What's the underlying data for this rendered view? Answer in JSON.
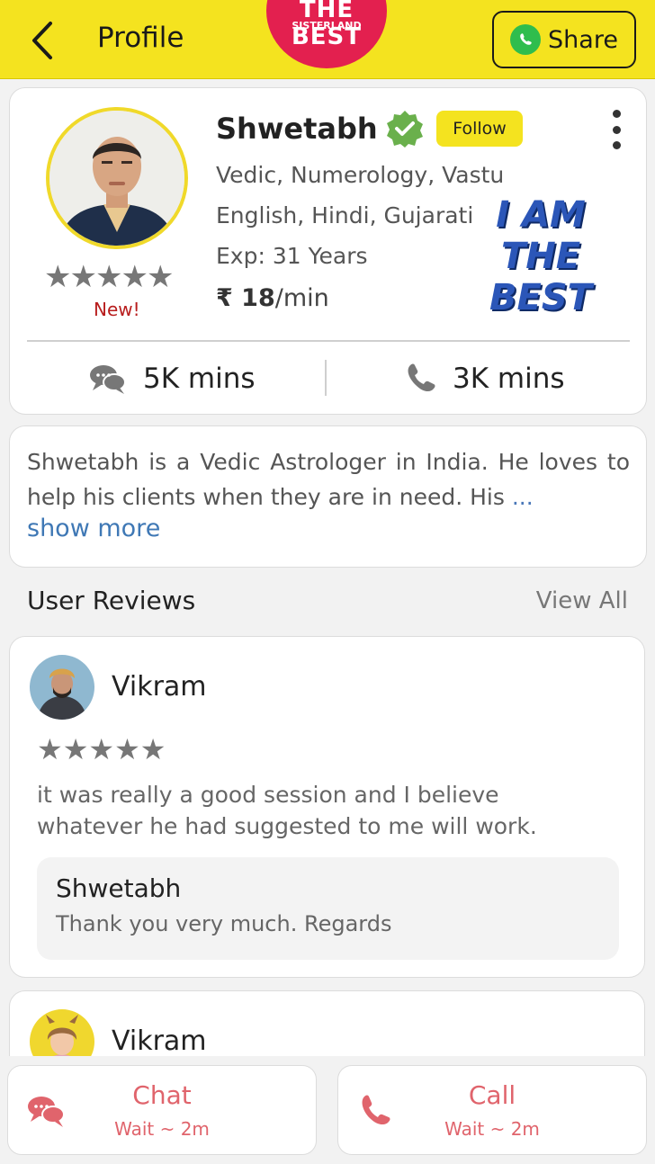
{
  "header": {
    "title": "Profile",
    "sticker_text": "THE BEST",
    "sticker_sub": "SISTERLAND",
    "share_label": "Share"
  },
  "profile": {
    "name": "Shwetabh",
    "follow_label": "Follow",
    "rating_stars": 5,
    "new_label": "New!",
    "skills": "Vedic, Numerology, Vastu",
    "languages": "English, Hindi, Gujarati",
    "experience": "Exp: 31 Years",
    "price_value": "₹ 18",
    "price_unit": "/min",
    "badge_lines": [
      "I AM",
      "THE",
      "BEST"
    ],
    "chat_minutes": "5K mins",
    "call_minutes": "3K mins"
  },
  "about": {
    "text": "Shwetabh is a Vedic Astrologer in India. He loves to help his clients when they are in need. His",
    "ellipsis": "...",
    "show_more": "show more"
  },
  "reviews": {
    "title": "User Reviews",
    "view_all": "View All",
    "items": [
      {
        "name": "Vikram",
        "stars": 5,
        "text": "it was really a good session and I believe whatever he had suggested to me will work.",
        "reply_name": "Shwetabh",
        "reply_text": "Thank you very much. Regards"
      },
      {
        "name": "Vikram"
      }
    ]
  },
  "actions": {
    "chat_label": "Chat",
    "chat_wait": "Wait ~ 2m",
    "call_label": "Call",
    "call_wait": "Wait ~ 2m"
  },
  "colors": {
    "header_bg": "#f4e31f",
    "accent_red": "#e0646c",
    "verified_green": "#6ab04c",
    "link_blue": "#3f78b5"
  }
}
